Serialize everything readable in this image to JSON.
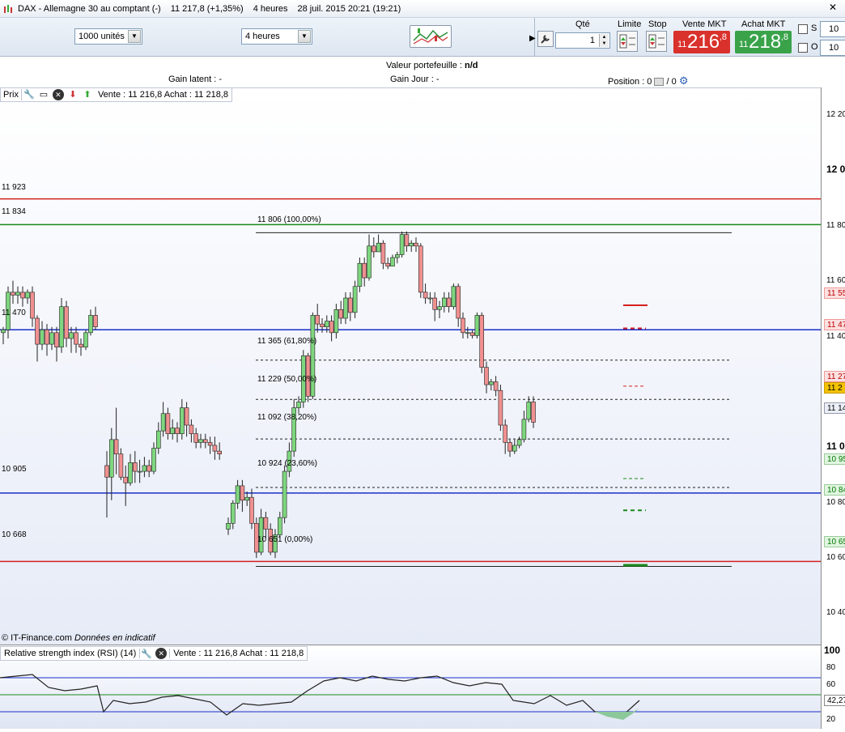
{
  "window": {
    "instrument": "DAX - Allemagne 30 au comptant (-)",
    "last": "11 217,8 (+1,35%)",
    "timeframe": "4 heures",
    "datetime": "28 juil. 2015 20:21 (19:21)",
    "close_icon": "x-icon"
  },
  "toolbar": {
    "units_select": "1000 unités",
    "period_select": "4 heures",
    "qty_label": "Qté",
    "qty_value": "1",
    "limit_label": "Limite",
    "stop_label": "Stop",
    "sell_label": "Vente MKT",
    "buy_label": "Achat MKT",
    "sell_prefix": "11",
    "sell_main": "216",
    "sell_sup": ",8",
    "buy_prefix": "11",
    "buy_main": "218",
    "buy_sup": ",8",
    "s_label": "S",
    "o_label": "O",
    "s_value": "10",
    "o_value": "10",
    "colors": {
      "sell": "#d9312c",
      "buy": "#3aa34a"
    }
  },
  "info": {
    "portfolio_label": "Valeur portefeuille : ",
    "portfolio_value": "n/d",
    "latent_gain": "Gain latent : -",
    "day_gain": "Gain Jour : -",
    "position": "Position : 0",
    "position_b": "/ 0"
  },
  "legend": {
    "tag": "Prix",
    "quote": "Vente : 11 216,8 Achat : 11 218,8"
  },
  "credit": {
    "source": "© IT-Finance.com ",
    "note": "Données en indicatif"
  },
  "levels": {
    "red_top": "11 923",
    "green_top": "11 834",
    "blue_mid": "11 470",
    "blue_low": "10 905",
    "red_low": "10 668"
  },
  "fib": {
    "f100": "11 806 (100,00%)",
    "f618": "11 365 (61,80%)",
    "f50": "11 229 (50,00%)",
    "f382": "11 092 (38,20%)",
    "f236": "10 924 (23,60%)",
    "f0": "10 651 (0,00%)"
  },
  "yaxis": {
    "labels": [
      "12 20",
      "12 0",
      "11 80",
      "11 60",
      "11 40",
      "11 0",
      "10 80",
      "10 60",
      "10 40"
    ],
    "tags": [
      "11 55",
      "11 47",
      "11 27",
      "11 2",
      "11 14",
      "10 95",
      "10 84",
      "10 65"
    ],
    "rsi_labels": [
      "100",
      "80",
      "60",
      "42,27",
      "20"
    ]
  },
  "rsi": {
    "title": "Relative strength index (RSI) (14)",
    "quote": "Vente : 11 216,8 Achat : 11 218,8"
  },
  "chart_data": {
    "type": "candlestick",
    "ylim": [
      10400,
      12250
    ],
    "candles": [
      [
        11460,
        11470,
        11420,
        11480
      ],
      [
        11470,
        11600,
        11440,
        11620
      ],
      [
        11600,
        11590,
        11560,
        11640
      ],
      [
        11590,
        11600,
        11560,
        11620
      ],
      [
        11600,
        11580,
        11550,
        11620
      ],
      [
        11580,
        11600,
        11560,
        11610
      ],
      [
        11600,
        11510,
        11480,
        11620
      ],
      [
        11510,
        11420,
        11360,
        11520
      ],
      [
        11420,
        11470,
        11400,
        11500
      ],
      [
        11470,
        11420,
        11380,
        11490
      ],
      [
        11420,
        11460,
        11400,
        11480
      ],
      [
        11460,
        11410,
        11360,
        11480
      ],
      [
        11410,
        11550,
        11390,
        11580
      ],
      [
        11550,
        11440,
        11410,
        11570
      ],
      [
        11440,
        11460,
        11390,
        11480
      ],
      [
        11460,
        11420,
        11390,
        11480
      ],
      [
        11420,
        11410,
        11380,
        11440
      ],
      [
        11410,
        11460,
        11400,
        11470
      ],
      [
        11460,
        11520,
        11450,
        11540
      ],
      [
        11520,
        11480,
        11470,
        11550
      ],
      [
        11000,
        10960,
        10820,
        11050
      ],
      [
        10960,
        11090,
        10880,
        11130
      ],
      [
        11090,
        11040,
        10970,
        11200
      ],
      [
        11040,
        10960,
        10950,
        11060
      ],
      [
        10960,
        10940,
        10860,
        11000
      ],
      [
        10940,
        11010,
        10930,
        11040
      ],
      [
        11010,
        10980,
        10940,
        11050
      ],
      [
        10980,
        10980,
        10940,
        11020
      ],
      [
        10980,
        11000,
        10960,
        11030
      ],
      [
        11000,
        10980,
        10960,
        11020
      ],
      [
        10980,
        11060,
        10970,
        11080
      ],
      [
        11060,
        11120,
        11040,
        11150
      ],
      [
        11120,
        11180,
        11100,
        11220
      ],
      [
        11180,
        11110,
        11090,
        11200
      ],
      [
        11110,
        11130,
        11090,
        11160
      ],
      [
        11130,
        11110,
        11080,
        11150
      ],
      [
        11110,
        11200,
        11090,
        11230
      ],
      [
        11200,
        11140,
        11100,
        11220
      ],
      [
        11140,
        11110,
        11080,
        11160
      ],
      [
        11110,
        11080,
        11060,
        11130
      ],
      [
        11080,
        11090,
        11060,
        11110
      ],
      [
        11090,
        11080,
        11060,
        11110
      ],
      [
        11080,
        11070,
        11040,
        11100
      ],
      [
        11070,
        11050,
        11020,
        11100
      ],
      [
        11050,
        11040,
        11020,
        11080
      ],
      [
        10780,
        10800,
        10760,
        10820
      ],
      [
        10800,
        10870,
        10780,
        10880
      ],
      [
        10870,
        10930,
        10850,
        10950
      ],
      [
        10930,
        10880,
        10840,
        10950
      ],
      [
        10880,
        10890,
        10860,
        10910
      ],
      [
        10890,
        10800,
        10780,
        10920
      ],
      [
        10800,
        10700,
        10680,
        10820
      ],
      [
        10700,
        10820,
        10690,
        10850
      ],
      [
        10820,
        10780,
        10750,
        10840
      ],
      [
        10780,
        10700,
        10690,
        10800
      ],
      [
        10700,
        10760,
        10680,
        10780
      ],
      [
        10760,
        10820,
        10750,
        10840
      ],
      [
        10820,
        10980,
        10800,
        11000
      ],
      [
        10980,
        11050,
        10960,
        11080
      ],
      [
        11050,
        11200,
        11030,
        11230
      ],
      [
        11200,
        11220,
        11180,
        11240
      ],
      [
        11220,
        11380,
        11200,
        11400
      ],
      [
        11380,
        11240,
        11220,
        11390
      ],
      [
        11240,
        11520,
        11230,
        11530
      ],
      [
        11520,
        11490,
        11460,
        11560
      ],
      [
        11490,
        11480,
        11460,
        11510
      ],
      [
        11480,
        11500,
        11460,
        11520
      ],
      [
        11500,
        11460,
        11430,
        11520
      ],
      [
        11460,
        11540,
        11440,
        11560
      ],
      [
        11540,
        11510,
        11490,
        11570
      ],
      [
        11510,
        11580,
        11490,
        11600
      ],
      [
        11580,
        11530,
        11500,
        11600
      ],
      [
        11530,
        11620,
        11510,
        11640
      ],
      [
        11620,
        11700,
        11600,
        11720
      ],
      [
        11700,
        11650,
        11620,
        11720
      ],
      [
        11650,
        11760,
        11640,
        11800
      ],
      [
        11760,
        11740,
        11720,
        11790
      ],
      [
        11740,
        11770,
        11740,
        11800
      ],
      [
        11770,
        11700,
        11680,
        11780
      ],
      [
        11700,
        11690,
        11680,
        11720
      ],
      [
        11690,
        11720,
        11690,
        11730
      ],
      [
        11720,
        11730,
        11700,
        11740
      ],
      [
        11730,
        11800,
        11720,
        11810
      ],
      [
        11800,
        11760,
        11740,
        11810
      ],
      [
        11760,
        11770,
        11740,
        11780
      ],
      [
        11770,
        11760,
        11740,
        11790
      ],
      [
        11760,
        11600,
        11580,
        11770
      ],
      [
        11600,
        11580,
        11560,
        11630
      ],
      [
        11580,
        11580,
        11560,
        11600
      ],
      [
        11580,
        11540,
        11500,
        11600
      ],
      [
        11540,
        11550,
        11510,
        11570
      ],
      [
        11550,
        11580,
        11530,
        11600
      ],
      [
        11580,
        11550,
        11530,
        11600
      ],
      [
        11550,
        11620,
        11540,
        11630
      ],
      [
        11620,
        11510,
        11480,
        11630
      ],
      [
        11510,
        11460,
        11440,
        11530
      ],
      [
        11460,
        11460,
        11440,
        11480
      ],
      [
        11460,
        11450,
        11440,
        11470
      ],
      [
        11450,
        11520,
        11440,
        11530
      ],
      [
        11520,
        11340,
        11320,
        11530
      ],
      [
        11340,
        11280,
        11250,
        11360
      ],
      [
        11280,
        11290,
        11260,
        11300
      ],
      [
        11290,
        11260,
        11240,
        11310
      ],
      [
        11260,
        11140,
        11120,
        11280
      ],
      [
        11140,
        11080,
        11040,
        11160
      ],
      [
        11080,
        11050,
        11030,
        11090
      ],
      [
        11050,
        11070,
        11040,
        11090
      ],
      [
        11070,
        11090,
        11060,
        11100
      ],
      [
        11090,
        11160,
        11080,
        11190
      ],
      [
        11160,
        11220,
        11150,
        11240
      ],
      [
        11220,
        11150,
        11130,
        11240
      ]
    ]
  }
}
